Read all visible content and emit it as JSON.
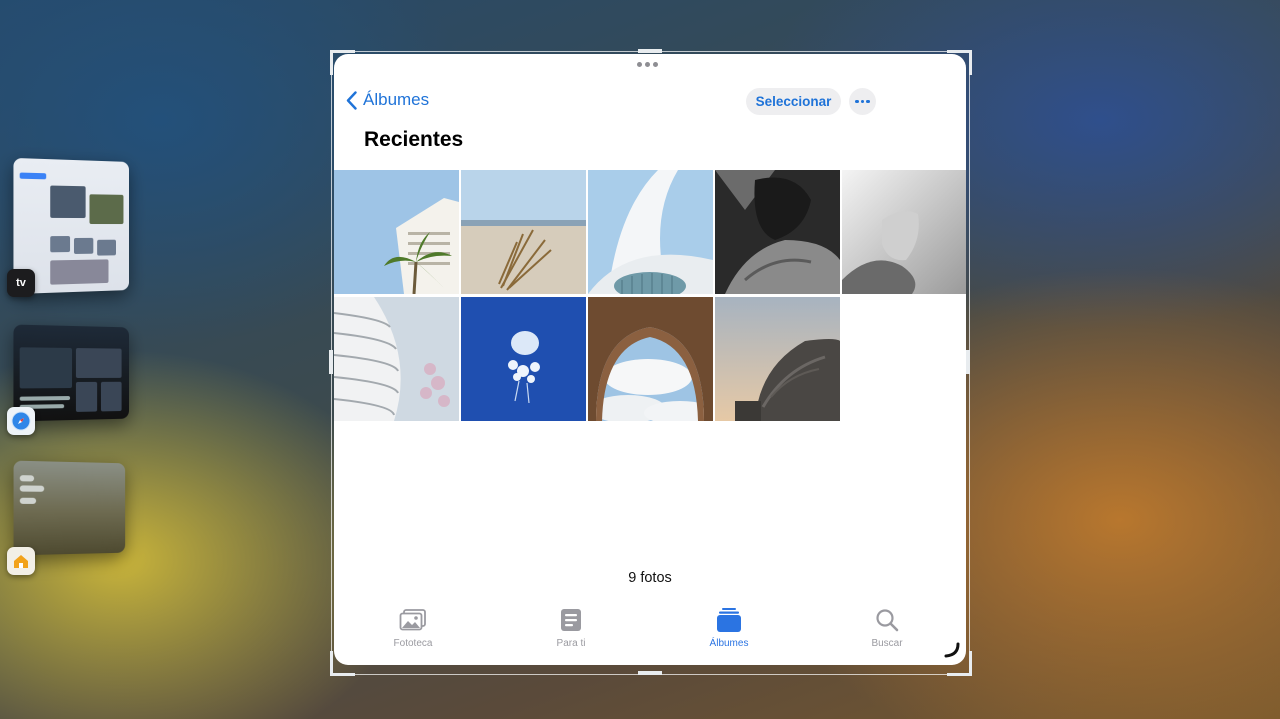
{
  "stage_manager": {
    "apps": [
      {
        "name": "tv-app",
        "icon_label": "tv"
      },
      {
        "name": "safari"
      },
      {
        "name": "home"
      }
    ]
  },
  "photos_app": {
    "back_label": "Álbumes",
    "select_label": "Seleccionar",
    "title": "Recientes",
    "photo_count": "9 fotos",
    "tabs": [
      {
        "label": "Fototeca",
        "active": false
      },
      {
        "label": "Para ti",
        "active": false
      },
      {
        "label": "Álbumes",
        "active": true
      },
      {
        "label": "Buscar",
        "active": false
      }
    ],
    "accent_color": "#2b74e2",
    "photos": [
      "building-with-palm-trees",
      "dry-plant-on-beach",
      "white-futuristic-arch",
      "hands-black-and-white",
      "baby-feet-black-and-white",
      "curved-white-building",
      "jellyfish-blue-water",
      "stone-arch-with-clouds",
      "building-at-dusk"
    ]
  }
}
